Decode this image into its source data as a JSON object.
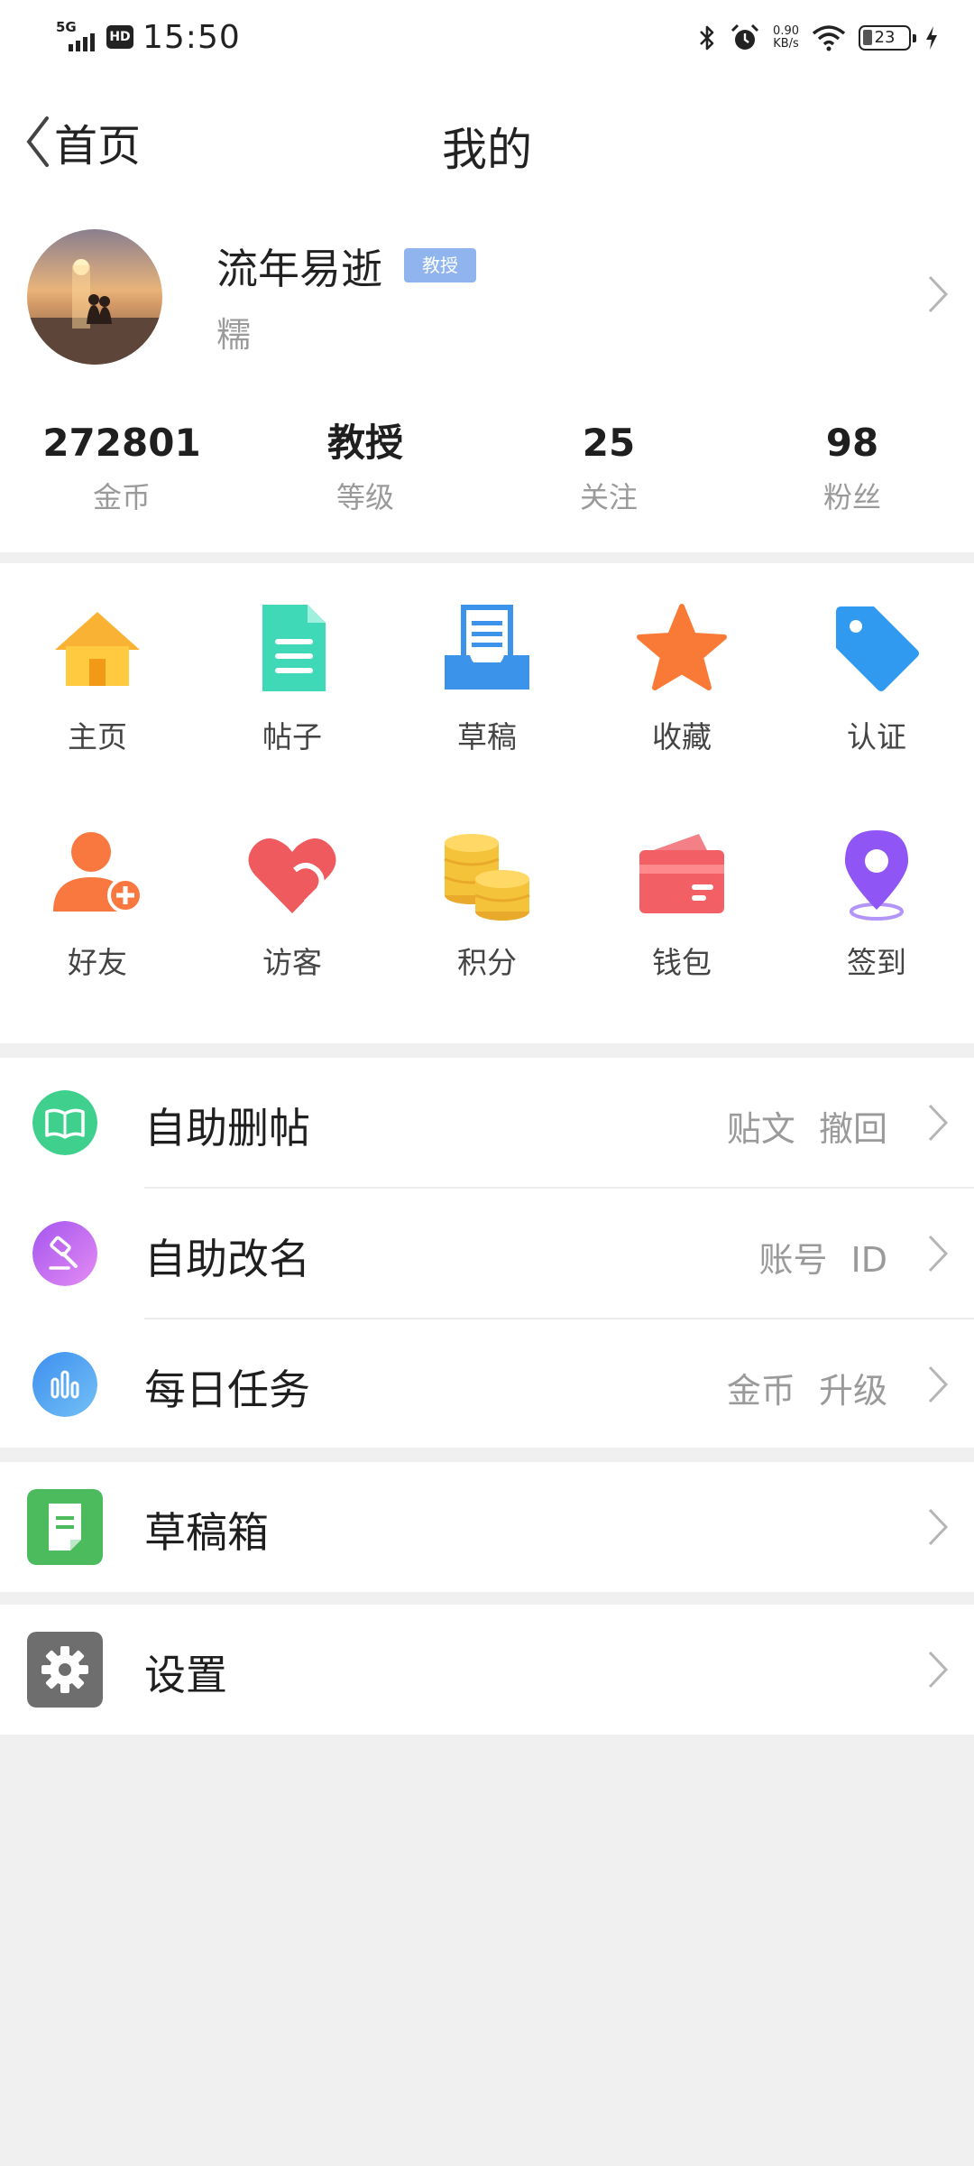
{
  "status_bar": {
    "network": "5G",
    "hd": "HD",
    "time": "15:50",
    "speed_value": "0.90",
    "speed_unit": "KB/s",
    "battery": "23",
    "icons": [
      "bluetooth-icon",
      "alarm-icon",
      "wifi-icon",
      "battery-icon",
      "charging-icon"
    ]
  },
  "header": {
    "back_label": "首页",
    "title": "我的"
  },
  "profile": {
    "username": "流年易逝",
    "badge": "教授",
    "signature": "糯",
    "stats": [
      {
        "value": "272801",
        "label": "金币"
      },
      {
        "value": "教授",
        "label": "等级"
      },
      {
        "value": "25",
        "label": "关注"
      },
      {
        "value": "98",
        "label": "粉丝"
      }
    ]
  },
  "grid": {
    "items": [
      {
        "label": "主页",
        "icon": "home-icon",
        "color": "#f9b233"
      },
      {
        "label": "帖子",
        "icon": "document-icon",
        "color": "#3fd9b8"
      },
      {
        "label": "草稿",
        "icon": "draft-tray-icon",
        "color": "#3b94ea"
      },
      {
        "label": "收藏",
        "icon": "star-icon",
        "color": "#f97a37"
      },
      {
        "label": "认证",
        "icon": "tag-icon",
        "color": "#2f9af0"
      },
      {
        "label": "好友",
        "icon": "add-friend-icon",
        "color": "#f9783f"
      },
      {
        "label": "访客",
        "icon": "heart-icon",
        "color": "#ef5a5f"
      },
      {
        "label": "积分",
        "icon": "coins-icon",
        "color": "#f5c33a"
      },
      {
        "label": "钱包",
        "icon": "wallet-icon",
        "color": "#f26065"
      },
      {
        "label": "签到",
        "icon": "location-pin-icon",
        "color": "#8f55f5"
      }
    ]
  },
  "list_main": [
    {
      "label": "自助删帖",
      "extra": "贴文 撤回",
      "icon": "book-icon",
      "color": "#3fd08e"
    },
    {
      "label": "自助改名",
      "extra": "账号 ID",
      "icon": "hammer-icon",
      "color": "#c36af0"
    },
    {
      "label": "每日任务",
      "extra": "金币 升级",
      "icon": "bar-chart-icon",
      "color": "#4aa3f0"
    }
  ],
  "drafts": {
    "label": "草稿箱",
    "icon": "draft-box-icon",
    "color": "#4cbb5e"
  },
  "settings": {
    "label": "设置",
    "icon": "gear-icon",
    "color": "#6e6e6e"
  }
}
